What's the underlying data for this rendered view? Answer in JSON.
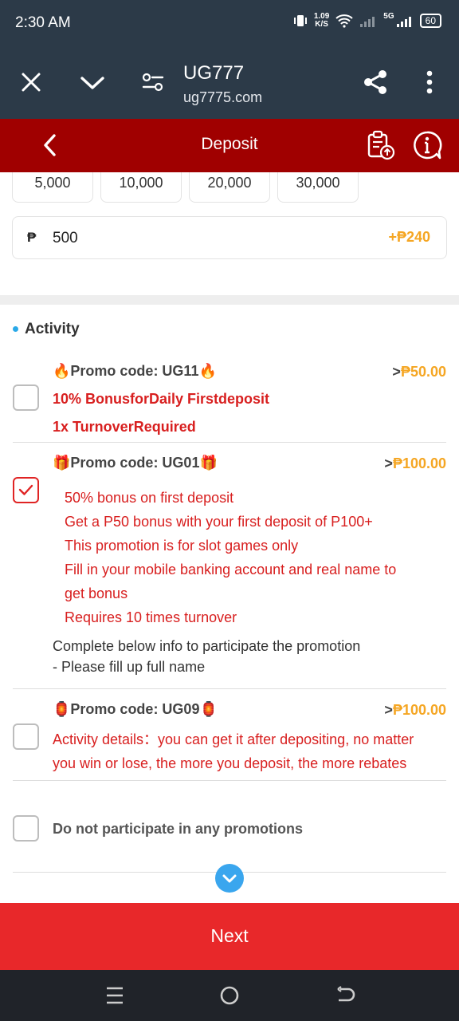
{
  "status_bar": {
    "time": "2:30 AM",
    "net_speed_value": "1.09",
    "net_speed_unit": "K/S",
    "signal_label": "5G",
    "battery": "60"
  },
  "browser": {
    "site_title": "UG777",
    "site_url": "ug7775.com"
  },
  "header": {
    "title": "Deposit"
  },
  "amounts": {
    "chips": [
      "5,000",
      "10,000",
      "20,000",
      "30,000"
    ],
    "currency_symbol": "₱",
    "input_value": "500",
    "bonus": "+₱240"
  },
  "activity": {
    "title": "Activity",
    "promos": [
      {
        "title": "Promo code: UG11",
        "emoji": "🔥",
        "amount_prefix": ">",
        "amount": "₱50.00",
        "checked": false,
        "lines": [
          "10% BonusforDaily Firstdeposit",
          "1x TurnoverRequired"
        ]
      },
      {
        "title": "Promo code: UG01",
        "emoji": "🎁",
        "amount_prefix": ">",
        "amount": "₱100.00",
        "checked": true,
        "lines": [
          "50% bonus on first deposit",
          "Get a P50 bonus with your first deposit of P100+",
          "This promotion is for slot games only",
          "Fill in your mobile banking account and real name to",
          "get bonus",
          "Requires 10 times turnover"
        ],
        "info_lines": [
          "Complete below info to participate the promotion",
          "- Please fill up full name"
        ]
      },
      {
        "title": "Promo code: UG09",
        "emoji": "🏮",
        "amount_prefix": ">",
        "amount": "₱100.00",
        "checked": false,
        "description": "Activity details：you can get it after depositing, no matter you win or lose, the more you deposit, the more rebates you will get"
      }
    ],
    "no_promo_label": "Do not participate in any promotions"
  },
  "footer": {
    "next_label": "Next"
  },
  "colors": {
    "header_bg": "#a00000",
    "browser_bg": "#2c3a48",
    "accent_red": "#d81f1f",
    "next_button": "#e8282a",
    "bonus_orange": "#f5a623",
    "info_blue": "#2aa9e8"
  },
  "icons": {
    "browser": [
      "close-icon",
      "chevron-down-icon",
      "site-settings-icon",
      "share-icon",
      "more-vertical-icon"
    ],
    "header": [
      "back-arrow-icon",
      "clipboard-upload-icon",
      "help-circle-icon"
    ],
    "nav": [
      "recent-apps-icon",
      "home-icon",
      "back-icon"
    ]
  }
}
